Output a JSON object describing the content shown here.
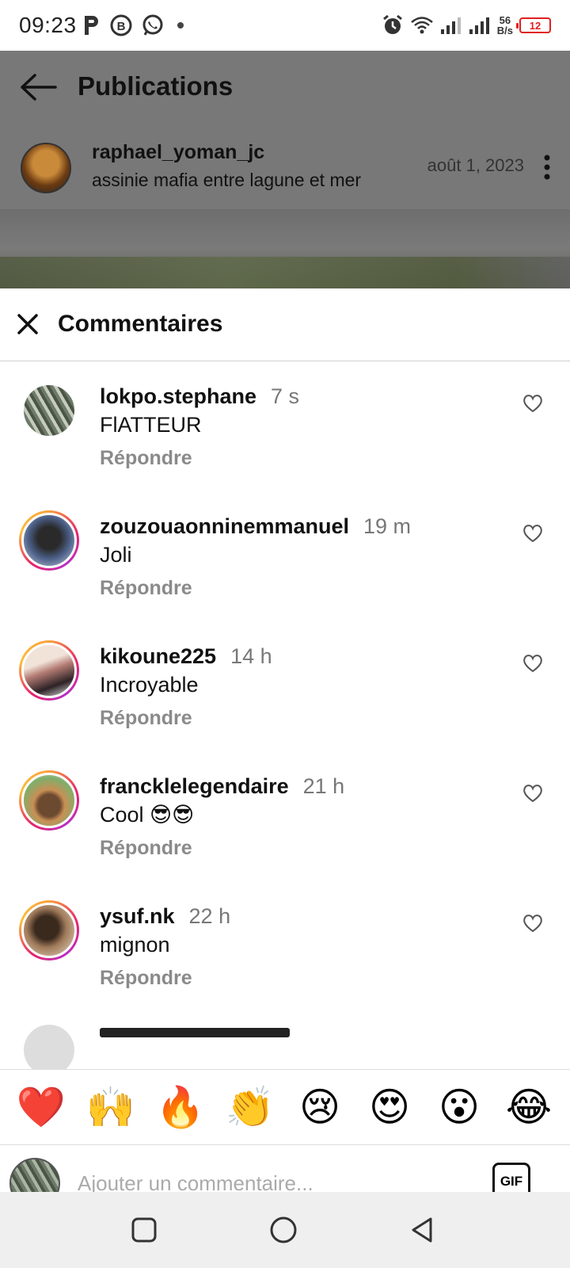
{
  "status_bar": {
    "time": "09:23",
    "net_speed_value": "56",
    "net_speed_unit": "B/s",
    "battery": "12",
    "icons": [
      "parking-icon",
      "b-circle-icon",
      "whatsapp-icon",
      "dot-icon",
      "alarm-icon",
      "wifi-icon",
      "signal-icon",
      "signal-icon",
      "battery-icon"
    ]
  },
  "post": {
    "header_title": "Publications",
    "username": "raphael_yoman_jc",
    "location": "assinie mafia entre lagune et mer",
    "date": "août 1, 2023"
  },
  "comments_sheet": {
    "title": "Commentaires",
    "reply_label": "Répondre",
    "comments": [
      {
        "username": "lokpo.stephane",
        "time": "7 s",
        "text": "FlATTEUR",
        "story_ring": false,
        "avatar_color": "#8a8f86"
      },
      {
        "username": "zouzouaonninemmanuel",
        "time": "19 m",
        "text": "Joli",
        "story_ring": true,
        "avatar_color": "#3b4a66"
      },
      {
        "username": "kikoune225",
        "time": "14 h",
        "text": "Incroyable",
        "story_ring": true,
        "avatar_color": "#a0706a"
      },
      {
        "username": "francklelegendaire",
        "time": "21 h",
        "text": "Cool 😎😎",
        "story_ring": true,
        "avatar_color": "#7a5a3a"
      },
      {
        "username": "ysuf.nk",
        "time": "22 h",
        "text": "mignon",
        "story_ring": true,
        "avatar_color": "#5a4a3a"
      }
    ]
  },
  "emoji_bar": [
    "❤️",
    "🙌",
    "🔥",
    "👏",
    "😢",
    "😍",
    "😮",
    "😂"
  ],
  "input": {
    "placeholder": "Ajouter un commentaire...",
    "gif_label": "GIF"
  },
  "colors": {
    "accent_text": "#111111",
    "muted_text": "#8a8a8a",
    "battery_low": "#e02020",
    "story_ring_start": "#f9a13a",
    "story_ring_end": "#b82fc6"
  }
}
